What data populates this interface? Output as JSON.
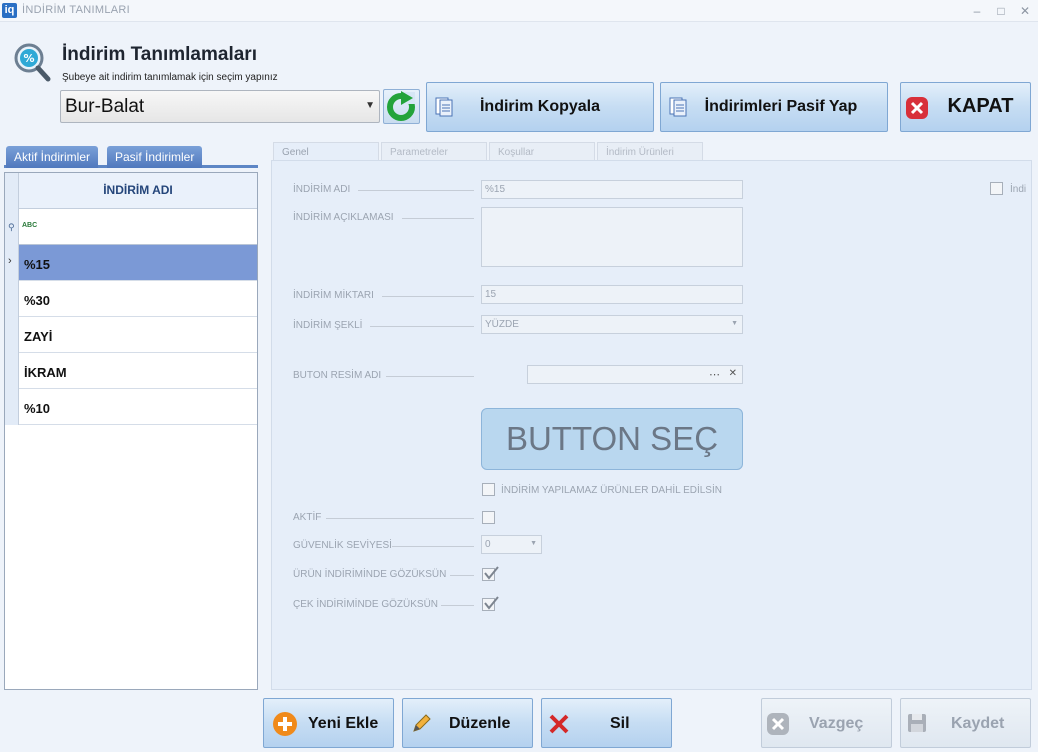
{
  "window": {
    "logo": "iq",
    "title": "İNDİRİM TANIMLARI",
    "controls": {
      "minimize": "–",
      "maximize": "□",
      "close": "✕"
    }
  },
  "header": {
    "title": "İndirim Tanımlamaları",
    "subtitle": "Şubeye ait indirim tanımlamak için seçim yapınız",
    "icon": "magnifier-percent-icon"
  },
  "branch": {
    "selected": "Bur-Balat"
  },
  "toolbar": {
    "copy_label": "İndirim Kopyala",
    "passive_label": "İndirimleri Pasif Yap",
    "close_label": "KAPAT"
  },
  "left_tabs": [
    "Aktif İndirimler",
    "Pasif İndirimler"
  ],
  "grid": {
    "column": "İNDİRİM ADI",
    "filter_icon_text": "ABC",
    "rows": [
      "%15",
      "%30",
      "ZAYİ",
      "İKRAM",
      "%10"
    ]
  },
  "right_tabs": [
    "Genel",
    "Parametreler",
    "Koşullar",
    "İndirim Ürünleri"
  ],
  "form": {
    "name_label": "İNDİRİM ADI",
    "name_value": "%15",
    "desc_label": "İNDİRİM AÇIKLAMASI",
    "amount_label": "İNDİRİM MİKTARI",
    "amount_value": "15",
    "type_label": "İNDİRİM ŞEKLİ",
    "type_value": "YÜZDE",
    "image_label": "BUTON RESİM ADI",
    "image_ellipsis": "⋯",
    "image_clear": "✕",
    "button_select": "BUTTON SEÇ",
    "include_label": "İNDİRİM YAPILAMAZ ÜRÜNLER DAHİL EDİLSİN",
    "active_label": "AKTİF",
    "security_label": "GÜVENLİK SEVİYESİ",
    "security_value": "0",
    "product_show_label": "ÜRÜN İNDİRİMİNDE GÖZÜKSÜN",
    "check_show_label": "ÇEK İNDİRİMİNDE GÖZÜKSÜN",
    "right_cut_label": "İndi"
  },
  "bottom": {
    "new_label": "Yeni Ekle",
    "edit_label": "Düzenle",
    "delete_label": "Sil",
    "cancel_label": "Vazgeç",
    "save_label": "Kaydet"
  },
  "colors": {
    "accent": "#5d86c5",
    "selected_row": "#7b99d6",
    "button_face": "#c6ddf3"
  }
}
